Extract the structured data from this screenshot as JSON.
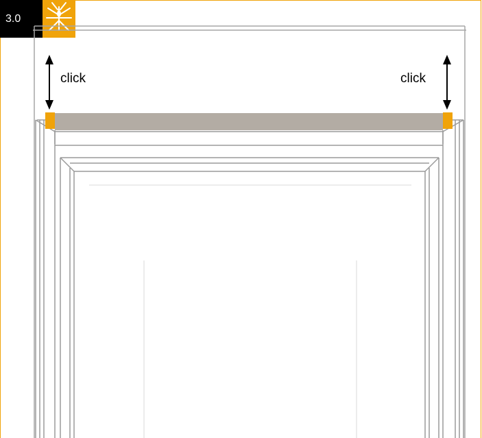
{
  "header": {
    "step_number": "3.0",
    "logo_icon": "mosquito-icon"
  },
  "annotations": {
    "left_label": "click",
    "right_label": "click"
  },
  "colors": {
    "accent": "#f0a30a",
    "rail": "#b3aca4",
    "frame_lines": "#9a9a9a"
  }
}
